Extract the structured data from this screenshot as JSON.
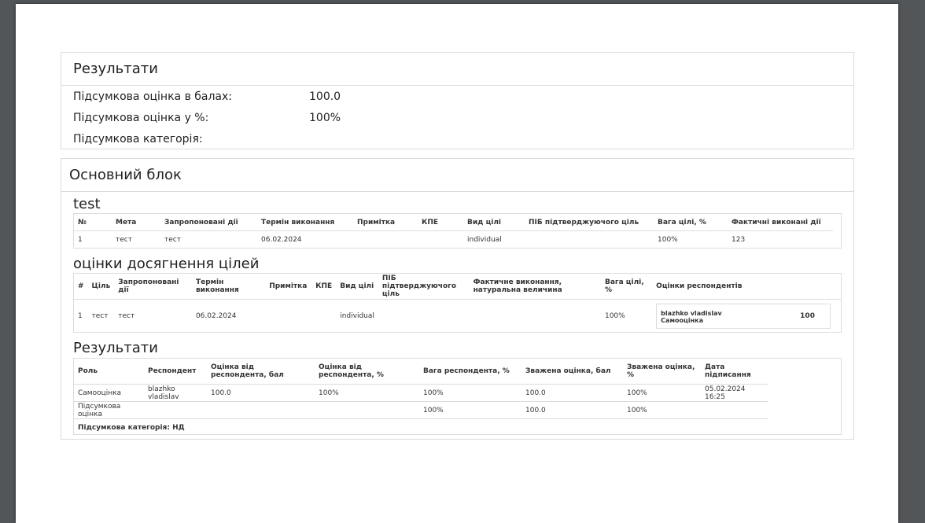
{
  "results_top": {
    "title": "Результати",
    "rows": [
      {
        "label": "Підсумкова оцінка в балах:",
        "value": "100.0"
      },
      {
        "label": "Підсумкова оцінка у %:",
        "value": "100%"
      },
      {
        "label": "Підсумкова категорія:",
        "value": ""
      }
    ]
  },
  "main_block": {
    "title": "Основний блок",
    "goals": {
      "title": "test",
      "headers": [
        "№",
        "Мета",
        "Запропоновані дії",
        "Термін виконання",
        "Примітка",
        "КПЕ",
        "Вид цілі",
        "ПІБ підтверджуючого ціль",
        "Вага цілі, %",
        "Фактичні виконані дії"
      ],
      "rows": [
        [
          "1",
          "тест",
          "тест",
          "06.02.2024",
          "",
          "",
          "individual",
          "",
          "100%",
          "123"
        ]
      ]
    },
    "assessments": {
      "title": "оцінки досягнення цілей",
      "headers": [
        "#",
        "Ціль",
        "Запропоновані дії",
        "Термін виконання",
        "Примітка",
        "КПЕ",
        "Вид цілі",
        "ПІБ підтверджуючого ціль",
        "Фактичне виконання, натуральна величина",
        "Вага цілі, %",
        "Оцінки респондентів"
      ],
      "rows": [
        {
          "cells": [
            "1",
            "тест",
            "тест",
            "06.02.2024",
            "",
            "",
            "individual",
            "",
            "",
            "100%"
          ],
          "respondent": {
            "name": "blazhko vladislav",
            "role": "Самооцінка",
            "score": "100"
          }
        }
      ]
    },
    "results": {
      "title": "Результати",
      "headers": [
        "Роль",
        "Респондент",
        "Оцінка від респондента, бал",
        "Оцінка від респондента, %",
        "Вага респондента, %",
        "Зважена оцінка, бал",
        "Зважена оцінка, %",
        "Дата підписання"
      ],
      "rows": [
        [
          "Самооцінка",
          "blazhko vladislav",
          "100.0",
          "100%",
          "100%",
          "100.0",
          "100%",
          "05.02.2024 16:25"
        ],
        [
          "Підсумкова оцінка",
          "",
          "",
          "",
          "100%",
          "100.0",
          "100%",
          ""
        ]
      ],
      "category": "Підсумкова категорія: НД"
    }
  }
}
